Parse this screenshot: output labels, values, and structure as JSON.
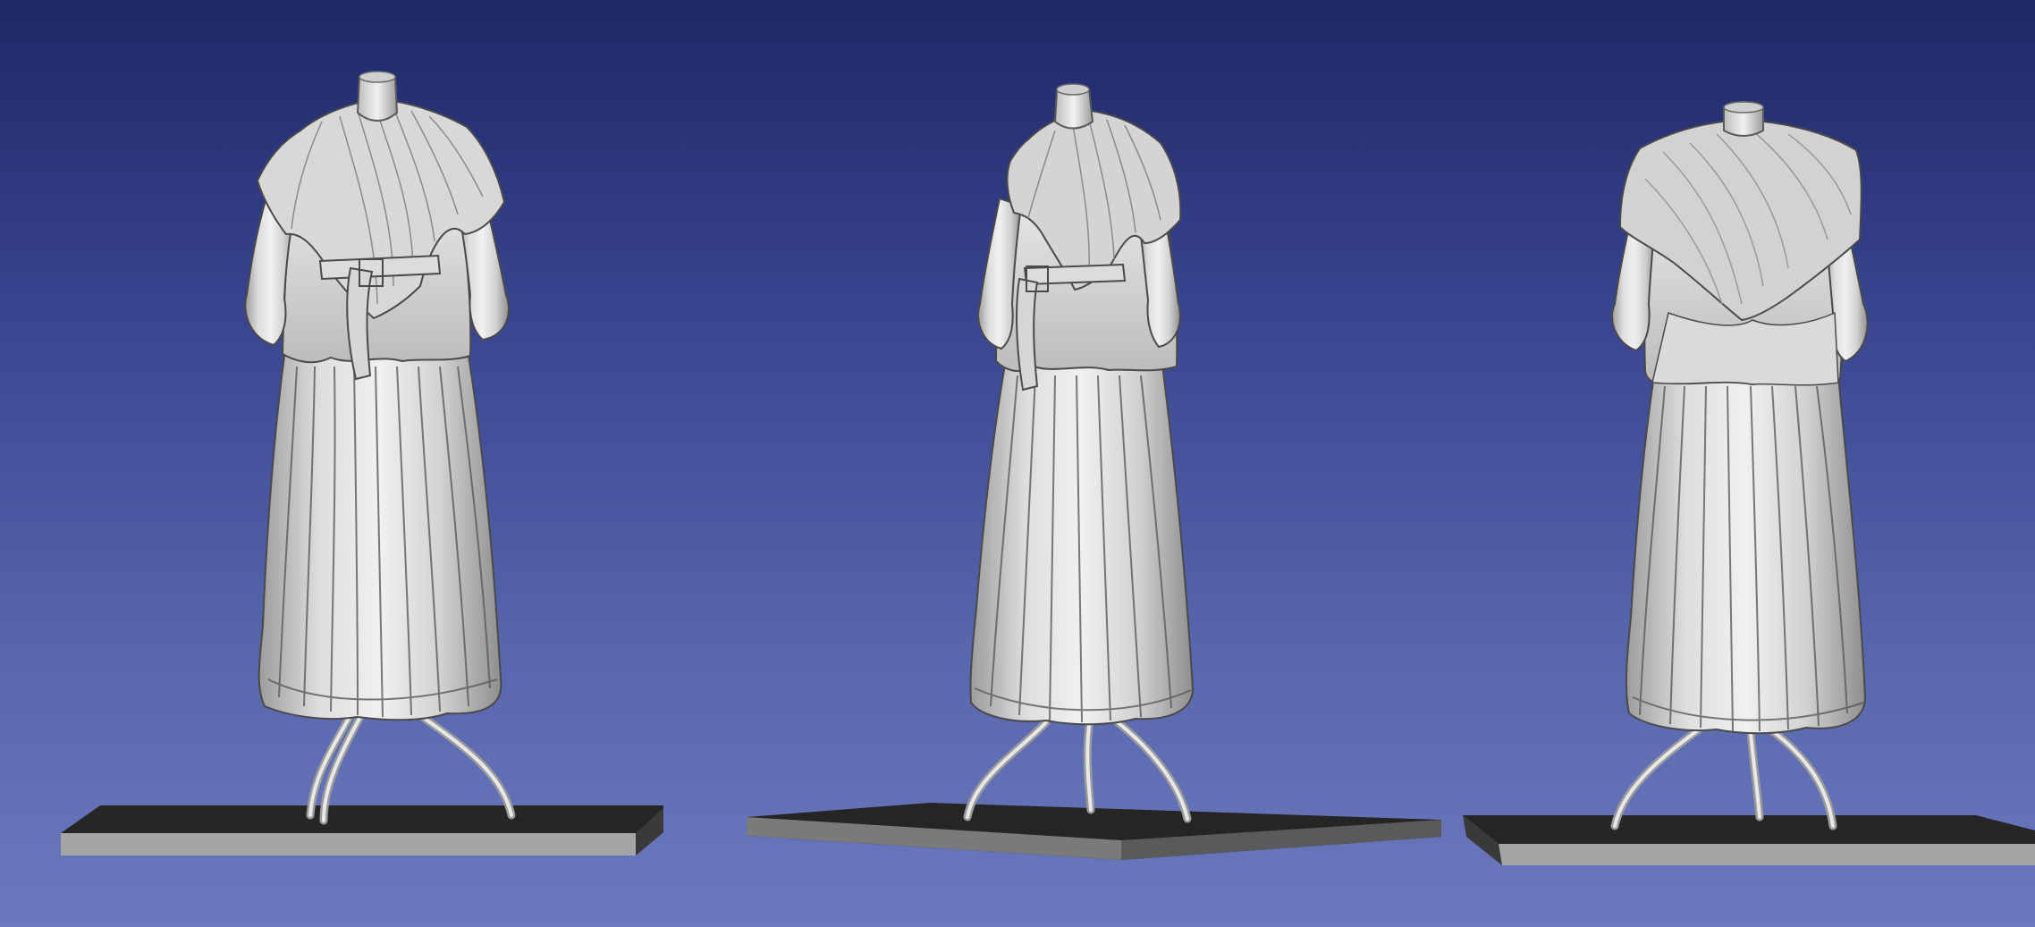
{
  "viewer": {
    "background_top": "#1f2766",
    "background_bottom": "#6c79be"
  },
  "models": [
    {
      "view": "front",
      "name": "mannequin-front-view"
    },
    {
      "view": "three-quarter",
      "name": "mannequin-three-quarter-view"
    },
    {
      "view": "back",
      "name": "mannequin-back-view"
    }
  ],
  "colors": {
    "mesh_light": "#e2e2e2",
    "mesh_mid": "#bdbdbd",
    "mesh_dark": "#8a8a8a",
    "line_dark": "#3c3c3c",
    "base_top": "#252525",
    "base_side": "#9e9e9e"
  }
}
